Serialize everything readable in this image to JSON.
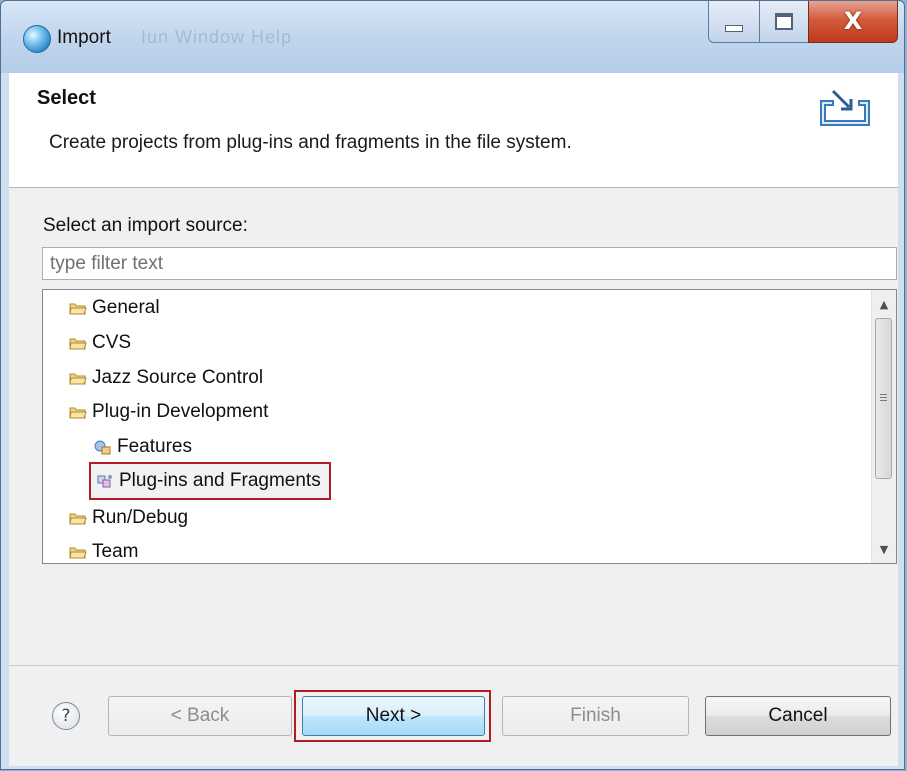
{
  "window": {
    "title": "Import",
    "ghost_title": "Iun  Window  Help"
  },
  "header": {
    "title": "Select",
    "description": "Create projects from plug-ins and fragments in the file system.",
    "icon": "import-wizard-icon"
  },
  "content": {
    "source_label": "Select an import source:",
    "filter_placeholder": "type filter text",
    "filter_value": ""
  },
  "tree": {
    "items": [
      {
        "label": "General",
        "icon": "folder-icon",
        "level": 0
      },
      {
        "label": "CVS",
        "icon": "folder-icon",
        "level": 0
      },
      {
        "label": "Jazz Source Control",
        "icon": "folder-icon",
        "level": 0
      },
      {
        "label": "Plug-in Development",
        "icon": "folder-open-icon",
        "level": 0
      },
      {
        "label": "Features",
        "icon": "feature-icon",
        "level": 1
      },
      {
        "label": "Plug-ins and Fragments",
        "icon": "plugin-icon",
        "level": 1,
        "selected": true
      },
      {
        "label": "Run/Debug",
        "icon": "folder-icon",
        "level": 0
      },
      {
        "label": "Team",
        "icon": "folder-icon",
        "level": 0
      }
    ]
  },
  "buttons": {
    "help": "?",
    "back": "< Back",
    "next": "Next >",
    "finish": "Finish",
    "cancel": "Cancel"
  },
  "colors": {
    "highlight": "#b01e23",
    "titlebar": "#c3d7ee",
    "close": "#c0391c"
  }
}
